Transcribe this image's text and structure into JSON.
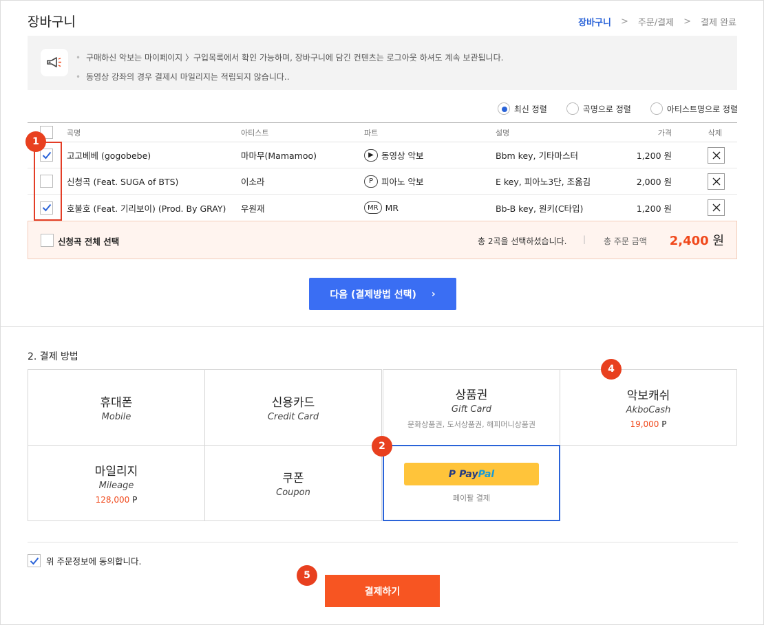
{
  "header": {
    "title": "장바구니",
    "steps": [
      "장바구니",
      "주문/결제",
      "결제 완료"
    ]
  },
  "notice": {
    "lines": [
      "구매하신 악보는 마이페이지 〉구입목록에서 확인 가능하며, 장바구니에 담긴 컨텐츠는 로그아웃 하셔도 계속 보관됩니다.",
      "동영상 강좌의 경우 결제시 마일리지는 적립되지 않습니다.."
    ],
    "icon": "megaphone-icon"
  },
  "sort": {
    "options": [
      "최신 정렬",
      "곡명으로 정렬",
      "아티스트명으로 정렬"
    ],
    "selected": 0
  },
  "table": {
    "headers": [
      "곡명",
      "아티스트",
      "파트",
      "설명",
      "가격",
      "삭제"
    ],
    "rows": [
      {
        "song": "고고베베 (gogobebe)",
        "artist": "마마무(Mamamoo)",
        "part_badge": "▶",
        "part": "동영상 악보",
        "desc": "Bbm key, 기타마스터",
        "price": "1,200 원",
        "checked": true
      },
      {
        "song": "신청곡 (Feat. SUGA of BTS)",
        "artist": "이소라",
        "part_badge": "P",
        "part": "피아노 악보",
        "desc": "E key, 피아노3단, 조옮김",
        "price": "2,000 원",
        "checked": false
      },
      {
        "song": "호불호 (Feat. 기리보이) (Prod. By GRAY)",
        "artist": "우원재",
        "part_badge": "MR",
        "part": "MR",
        "desc": "Bb-B key, 원키(C타입)",
        "price": "1,200 원",
        "checked": true
      }
    ]
  },
  "summary": {
    "select_all_label": "신청곡 전체 선택",
    "selected_text": "총 2곡을 선택하셨습니다.",
    "separator": "|",
    "total_label": "총 주문 금액",
    "total_value": "2,400",
    "total_unit": "원"
  },
  "next_button": {
    "label": "다음 (결제방법 선택)",
    "arrow": "›"
  },
  "payment": {
    "title": "2. 결제 방법",
    "methods": [
      {
        "ko": "휴대폰",
        "en": "Mobile"
      },
      {
        "ko": "신용카드",
        "en": "Credit Card"
      },
      {
        "ko": "상품권",
        "en": "Gift Card",
        "sub": "문화상품권, 도서상품권, 해피머니상품권"
      },
      {
        "ko": "악보캐쉬",
        "en": "AkboCash",
        "points": "19,000",
        "unit": "P"
      },
      {
        "ko": "마일리지",
        "en": "Mileage",
        "points": "128,000",
        "unit": "P"
      },
      {
        "ko": "쿠폰",
        "en": "Coupon"
      },
      {
        "paypal_left": "P PayPal",
        "paypal_brand_1": "Pay",
        "paypal_brand_2": "Pal",
        "paypal_mark": "P",
        "sub": "페이팔 결제"
      }
    ]
  },
  "agree": {
    "label": "위 주문정보에 동의합니다.",
    "checked": true
  },
  "pay_button": {
    "label": "결제하기"
  },
  "markers": [
    "1",
    "2",
    "4",
    "5"
  ],
  "colors": {
    "accent": "#2a63d8",
    "orange": "#f75522",
    "marker": "#e8401f",
    "button_blue": "#3a6ef3"
  }
}
